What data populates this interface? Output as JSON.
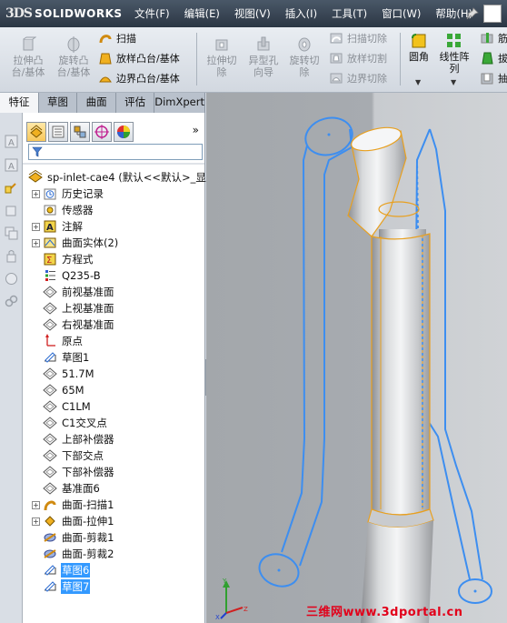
{
  "app": {
    "logo_prefix": "3DS",
    "logo_text": "SOLIDWORKS"
  },
  "menu": [
    {
      "label": "文件(F)"
    },
    {
      "label": "编辑(E)"
    },
    {
      "label": "视图(V)"
    },
    {
      "label": "插入(I)"
    },
    {
      "label": "工具(T)"
    },
    {
      "label": "窗口(W)"
    },
    {
      "label": "帮助(H)"
    }
  ],
  "commands": {
    "extrude_boss": {
      "label_1": "拉伸凸",
      "label_2": "台/基体"
    },
    "revolve_boss": {
      "label_1": "旋转凸",
      "label_2": "台/基体"
    },
    "sweep": "扫描",
    "loft": "放样凸台/基体",
    "boundary": "边界凸台/基体",
    "extrude_cut": {
      "label_1": "拉伸切",
      "label_2": "除"
    },
    "hole_wizard": {
      "label_1": "异型孔",
      "label_2": "向导"
    },
    "revolve_cut": {
      "label_1": "旋转切",
      "label_2": "除"
    },
    "swept_cut": "扫描切除",
    "lofted_cut": "放样切割",
    "boundary_cut": "边界切除",
    "fillet": "圆角",
    "linear_pattern": {
      "label_1": "线性阵",
      "label_2": "列"
    },
    "rib": "筋",
    "draft": "拔",
    "shell": "抽"
  },
  "tabs": [
    {
      "label": "特征",
      "active": true
    },
    {
      "label": "草图",
      "active": false
    },
    {
      "label": "曲面",
      "active": false
    },
    {
      "label": "评估",
      "active": false
    },
    {
      "label": "DimXpert",
      "active": false
    }
  ],
  "tree": {
    "more_glyph": "»",
    "root": "sp-inlet-cae4  (默认<<默认>_显",
    "items": [
      {
        "label": "历史记录",
        "icon": "history-icon",
        "expandable": true,
        "selected": false
      },
      {
        "label": "传感器",
        "icon": "sensor-icon",
        "expandable": false,
        "selected": false
      },
      {
        "label": "注解",
        "icon": "annotation-icon",
        "expandable": true,
        "selected": false
      },
      {
        "label": "曲面实体(2)",
        "icon": "surface-bodies-icon",
        "expandable": true,
        "selected": false
      },
      {
        "label": "方程式",
        "icon": "equation-icon",
        "expandable": false,
        "selected": false
      },
      {
        "label": "Q235-B",
        "icon": "material-icon",
        "expandable": false,
        "selected": false
      },
      {
        "label": "前视基准面",
        "icon": "plane-icon",
        "expandable": false,
        "selected": false
      },
      {
        "label": "上视基准面",
        "icon": "plane-icon",
        "expandable": false,
        "selected": false
      },
      {
        "label": "右视基准面",
        "icon": "plane-icon",
        "expandable": false,
        "selected": false
      },
      {
        "label": "原点",
        "icon": "origin-icon",
        "expandable": false,
        "selected": false
      },
      {
        "label": "草图1",
        "icon": "sketch-icon",
        "expandable": false,
        "selected": false
      },
      {
        "label": "51.7M",
        "icon": "plane-icon",
        "expandable": false,
        "selected": false
      },
      {
        "label": "65M",
        "icon": "plane-icon",
        "expandable": false,
        "selected": false
      },
      {
        "label": "C1LM",
        "icon": "plane-icon",
        "expandable": false,
        "selected": false
      },
      {
        "label": "C1交叉点",
        "icon": "plane-icon",
        "expandable": false,
        "selected": false
      },
      {
        "label": "上部补偿器",
        "icon": "plane-icon",
        "expandable": false,
        "selected": false
      },
      {
        "label": "下部交点",
        "icon": "plane-icon",
        "expandable": false,
        "selected": false
      },
      {
        "label": "下部补偿器",
        "icon": "plane-icon",
        "expandable": false,
        "selected": false
      },
      {
        "label": "基准面6",
        "icon": "plane-icon",
        "expandable": false,
        "selected": false
      },
      {
        "label": "曲面-扫描1",
        "icon": "surface-sweep-icon",
        "expandable": true,
        "selected": false
      },
      {
        "label": "曲面-拉伸1",
        "icon": "surface-extrude-icon",
        "expandable": true,
        "selected": false
      },
      {
        "label": "曲面-剪裁1",
        "icon": "surface-trim-icon",
        "expandable": false,
        "selected": false
      },
      {
        "label": "曲面-剪裁2",
        "icon": "surface-trim-icon",
        "expandable": false,
        "selected": false
      },
      {
        "label": "草图6",
        "icon": "sketch-icon",
        "expandable": false,
        "selected": true
      },
      {
        "label": "草图7",
        "icon": "sketch-icon",
        "expandable": false,
        "selected": true
      }
    ]
  },
  "viewport": {
    "watermark": "三维网www.3dportal.cn"
  },
  "colors": {
    "sketch": "#3d8ef0",
    "edge": "#e8a020",
    "selection": "#3399ff",
    "menubar": "#2f3a48"
  }
}
